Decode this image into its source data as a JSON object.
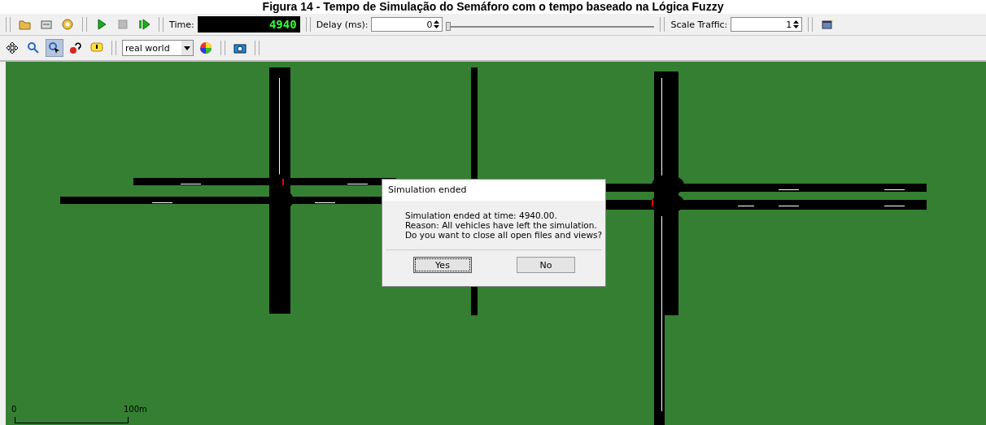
{
  "caption": "Figura 14 - Tempo de Simulação do Semáforo com o tempo baseado na Lógica Fuzzy",
  "toolbar": {
    "time_label": "Time:",
    "time_value": "4940",
    "delay_label": "Delay (ms):",
    "delay_value": "0",
    "delay_slider": {
      "level": 0
    },
    "scale_label": "Scale Traffic:",
    "scale_value": "1"
  },
  "view_toolbar": {
    "scheme": "real world",
    "locate_selected": true
  },
  "scale_bar": {
    "start": "0",
    "end": "100m"
  },
  "dialog": {
    "title": "Simulation ended",
    "lines": [
      "Simulation ended at time: 4940.00.",
      "Reason: All vehicles have left the simulation.",
      "Do you want to close all open files and views?"
    ],
    "buttons": [
      {
        "label": "Yes",
        "selected": true
      },
      {
        "label": "No",
        "selected": false
      }
    ]
  }
}
